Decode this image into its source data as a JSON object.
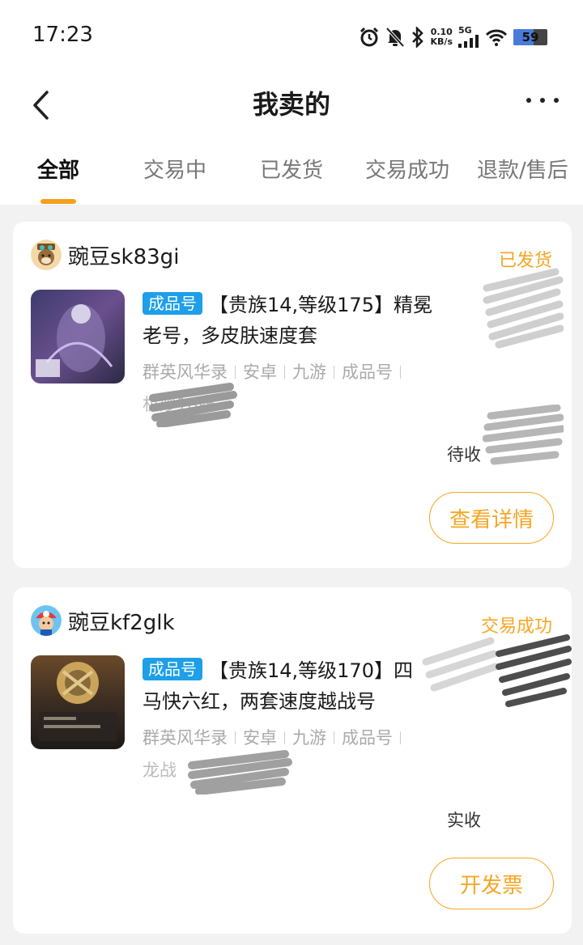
{
  "status_bar": {
    "time": "17:23",
    "net_speed_value": "0.10",
    "net_speed_unit": "KB/s",
    "network": "5G",
    "battery": "59",
    "battery_level": 0.59,
    "icons": [
      "alarm-icon",
      "bell-muted-icon",
      "bluetooth-icon",
      "signal-icon",
      "wifi-icon",
      "battery-icon"
    ]
  },
  "header": {
    "title": "我卖的",
    "back_icon": "chevron-left-icon",
    "more_icon": "more-dots-icon"
  },
  "tabs": [
    {
      "label": "全部",
      "active": true
    },
    {
      "label": "交易中",
      "active": false
    },
    {
      "label": "已发货",
      "active": false
    },
    {
      "label": "交易成功",
      "active": false
    },
    {
      "label": "退款/售后",
      "active": false
    }
  ],
  "orders": [
    {
      "seller": "豌豆sk83gi",
      "status": "已发货",
      "tag": "成品号",
      "title": "【贵族14,等级175】精冕",
      "title_line2": "老号，多皮肤速度套",
      "meta": [
        "群英风华录",
        "安卓",
        "九游",
        "成品号"
      ],
      "extra": "机妙18服",
      "amount_label": "待收",
      "action": "查看详情"
    },
    {
      "seller": "豌豆kf2glk",
      "status": "交易成功",
      "tag": "成品号",
      "title": "【贵族14,等级170】四",
      "title_line2": "马快六红，两套速度越战号",
      "meta": [
        "群英风华录",
        "安卓",
        "九游",
        "成品号"
      ],
      "extra": "龙战",
      "amount_label": "实收",
      "action": "开发票"
    }
  ],
  "colors": {
    "accent": "#f5a623",
    "tag_bg": "#1e9fe8",
    "page_bg": "#f2f2f2"
  }
}
